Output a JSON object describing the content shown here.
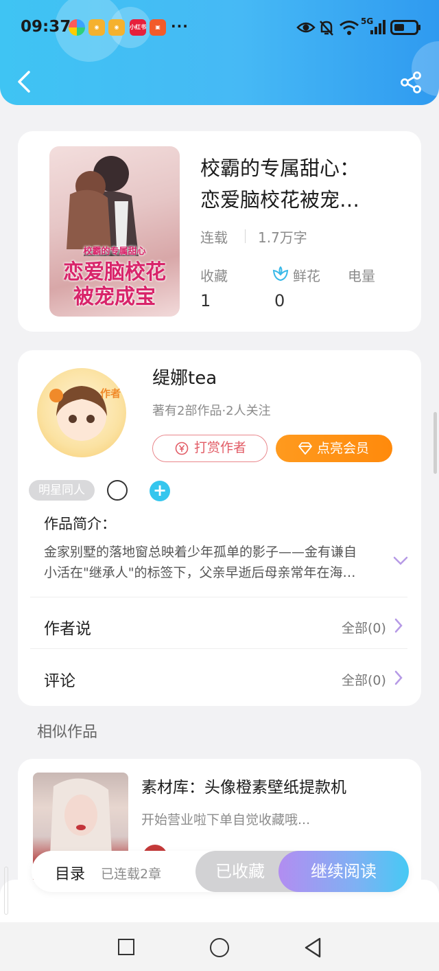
{
  "status_bar": {
    "time": "09:37",
    "more": "···",
    "network": "5G",
    "apps": [
      {
        "name": "app-icon",
        "color": "#3ba3ff",
        "label": ""
      },
      {
        "name": "weibo-icon",
        "color": "#f5a623",
        "label": ""
      },
      {
        "name": "weibo-icon",
        "color": "#f5a623",
        "label": ""
      },
      {
        "name": "xiaohongshu-icon",
        "color": "#e6203b",
        "label": "小红书"
      },
      {
        "name": "video-icon",
        "color": "#f25b2a",
        "label": ""
      }
    ]
  },
  "book": {
    "title_line1": "校霸的专属甜心：",
    "title_line2": "恋爱脑校花被宠…",
    "status": "连载",
    "word_count": "1.7万字",
    "cover_line1": "校霸的专属甜心",
    "cover_line2": "恋爱脑校花",
    "cover_line3": "被宠成宝",
    "stats": [
      {
        "label": "收藏",
        "value": "1"
      },
      {
        "label": "鲜花",
        "value": "0"
      },
      {
        "label": "电量",
        "value": ""
      }
    ]
  },
  "author": {
    "name": "缇娜tea",
    "badge": "作者",
    "info": "著有2部作品·2人关注",
    "tip_button": "打赏作者",
    "vip_button": "点亮会员",
    "tag": "明星同人"
  },
  "intro": {
    "title": "作品简介：",
    "line1": "金家别墅的落地窗总映着少年孤单的影子——金有谦自",
    "line2": "小活在\"继承人\"的标签下，父亲早逝后母亲常年在海…"
  },
  "rows": [
    {
      "title": "作者说",
      "right": "全部(0)"
    },
    {
      "title": "评论",
      "right": "全部(0)"
    }
  ],
  "similar": {
    "section_title": "相似作品",
    "title": "素材库：头像橙素壁纸提款机",
    "desc": "开始营业啦下单自觉收藏哦..."
  },
  "action_bar": {
    "toc": "目录",
    "toc_sub": "已连载2章",
    "favorited": "已收藏",
    "continue": "继续阅读"
  },
  "colors": {
    "header_blue": "#3fc4f3",
    "vip_orange": "#ff9a1e",
    "tip_red": "#e25c66",
    "accent_purple": "#b28df1",
    "accent_cyan": "#46c9f4"
  }
}
